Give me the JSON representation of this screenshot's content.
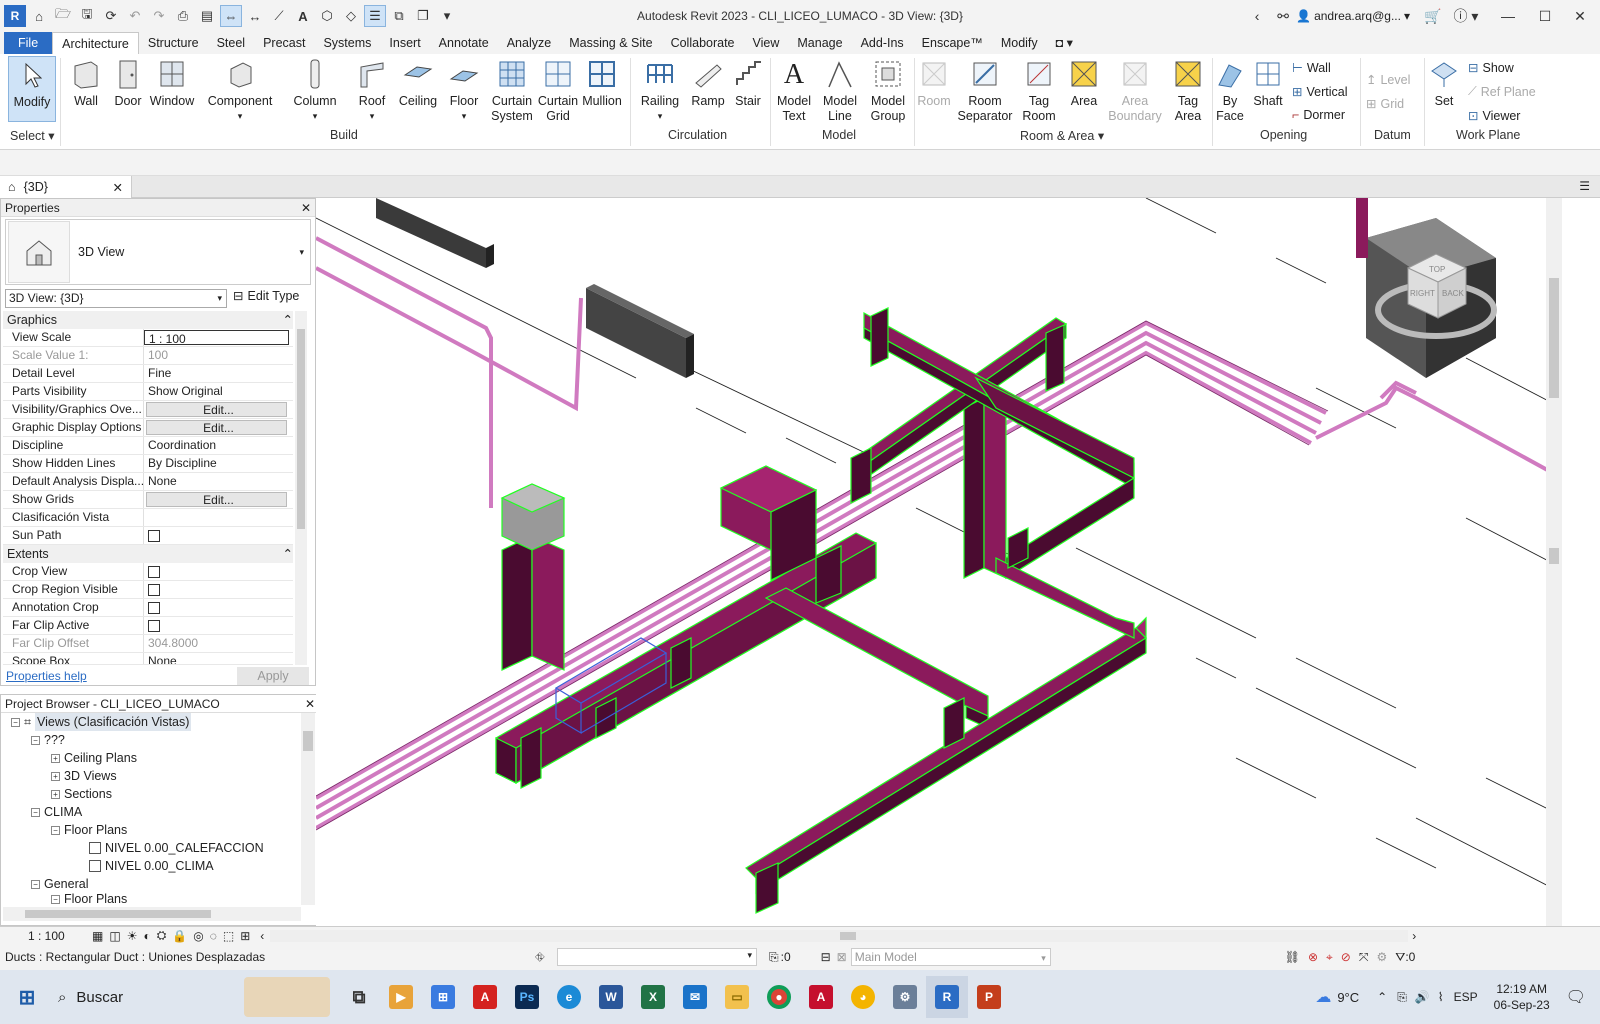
{
  "window": {
    "title": "Autodesk Revit 2023 - CLI_LICEO_LUMACO - 3D View: {3D}",
    "user": "andrea.arq@g...",
    "app_badge": "R"
  },
  "menu": {
    "tabs": [
      "File",
      "Architecture",
      "Structure",
      "Steel",
      "Precast",
      "Systems",
      "Insert",
      "Annotate",
      "Analyze",
      "Massing & Site",
      "Collaborate",
      "View",
      "Manage",
      "Add-Ins",
      "Enscape™",
      "Modify"
    ],
    "active": "Architecture"
  },
  "ribbon": {
    "select": {
      "modify": "Modify",
      "panel": "Select"
    },
    "build": {
      "panel": "Build",
      "wall": "Wall",
      "door": "Door",
      "window": "Window",
      "component": "Component",
      "column": "Column",
      "roof": "Roof",
      "ceiling": "Ceiling",
      "floor": "Floor",
      "curtain_system": [
        "Curtain",
        "System"
      ],
      "curtain_grid": [
        "Curtain",
        "Grid"
      ],
      "mullion": "Mullion"
    },
    "circulation": {
      "panel": "Circulation",
      "railing": "Railing",
      "ramp": "Ramp",
      "stair": "Stair"
    },
    "model": {
      "panel": "Model",
      "model_text": [
        "Model",
        "Text"
      ],
      "model_line": [
        "Model",
        "Line"
      ],
      "model_group": [
        "Model",
        "Group"
      ]
    },
    "room_area": {
      "panel": "Room & Area",
      "room": "Room",
      "room_separator": [
        "Room",
        "Separator"
      ],
      "tag_room": [
        "Tag",
        "Room"
      ],
      "area": "Area",
      "area_boundary": [
        "Area",
        "Boundary"
      ],
      "tag_area": [
        "Tag",
        "Area"
      ]
    },
    "opening": {
      "panel": "Opening",
      "by_face": [
        "By",
        "Face"
      ],
      "shaft": "Shaft",
      "wall": "Wall",
      "vertical": "Vertical",
      "dormer": "Dormer"
    },
    "datum": {
      "panel": "Datum",
      "level": "Level",
      "grid": "Grid"
    },
    "work_plane": {
      "panel": "Work Plane",
      "set": "Set",
      "show": "Show",
      "ref_plane": "Ref  Plane",
      "viewer": "Viewer"
    }
  },
  "view_tab": {
    "label": "{3D}"
  },
  "properties": {
    "header": "Properties",
    "type_name": "3D View",
    "selector": "3D View: {3D}",
    "edit_type": "Edit Type",
    "sections": {
      "graphics": "Graphics",
      "extents": "Extents"
    },
    "graphics_rows": [
      {
        "name": "View Scale",
        "value": "1 : 100"
      },
      {
        "name": "Scale Value    1:",
        "value": "100"
      },
      {
        "name": "Detail Level",
        "value": "Fine"
      },
      {
        "name": "Parts Visibility",
        "value": "Show Original"
      },
      {
        "name": "Visibility/Graphics Ove...",
        "value": "Edit..."
      },
      {
        "name": "Graphic Display Options",
        "value": "Edit..."
      },
      {
        "name": "Discipline",
        "value": "Coordination"
      },
      {
        "name": "Show Hidden Lines",
        "value": "By Discipline"
      },
      {
        "name": "Default Analysis Displa...",
        "value": "None"
      },
      {
        "name": "Show Grids",
        "value": "Edit..."
      },
      {
        "name": "Clasificación Vista",
        "value": ""
      },
      {
        "name": "Sun Path",
        "value": ""
      }
    ],
    "extents_rows": [
      {
        "name": "Crop View",
        "value": ""
      },
      {
        "name": "Crop Region Visible",
        "value": ""
      },
      {
        "name": "Annotation Crop",
        "value": ""
      },
      {
        "name": "Far Clip Active",
        "value": ""
      },
      {
        "name": "Far Clip Offset",
        "value": "304.8000"
      },
      {
        "name": "Scope Box",
        "value": "None"
      }
    ],
    "help": "Properties help",
    "apply": "Apply"
  },
  "browser": {
    "header": "Project Browser - CLI_LICEO_LUMACO",
    "items": [
      "Views (Clasificación Vistas)",
      "???",
      "Ceiling Plans",
      "3D Views",
      "Sections",
      "CLIMA",
      "Floor Plans",
      "NIVEL 0.00_CALEFACCION",
      "NIVEL 0.00_CLIMA",
      "General",
      "Floor Plans"
    ]
  },
  "viewcube": {
    "top": "TOP",
    "right": "RIGHT",
    "back": "BACK"
  },
  "view_control": {
    "scale": "1 : 100"
  },
  "status": {
    "text": "Ducts : Rectangular Duct : Uniones Desplazadas",
    "select_count": ":0",
    "model": "Main Model",
    "filter_count": ":0"
  },
  "taskbar": {
    "search": "Buscar",
    "weather": "9°C",
    "lang": "ESP",
    "time": "12:19 AM",
    "date": "06-Sep-23",
    "apps": [
      "Task View",
      "Media",
      "Store",
      "Acrobat",
      "Photoshop",
      "Edge",
      "Word",
      "Excel",
      "Mail",
      "Explorer",
      "Chrome",
      "AutoCAD",
      "Chrome profile",
      "Settings",
      "Revit",
      "PowerPoint"
    ]
  },
  "colors": {
    "duct": "#8b1a5c",
    "duct_dark": "#4a0b30",
    "pipe": "#d07ac0",
    "select": "#22ff22",
    "ribbon_blue": "#2b6cc4"
  }
}
